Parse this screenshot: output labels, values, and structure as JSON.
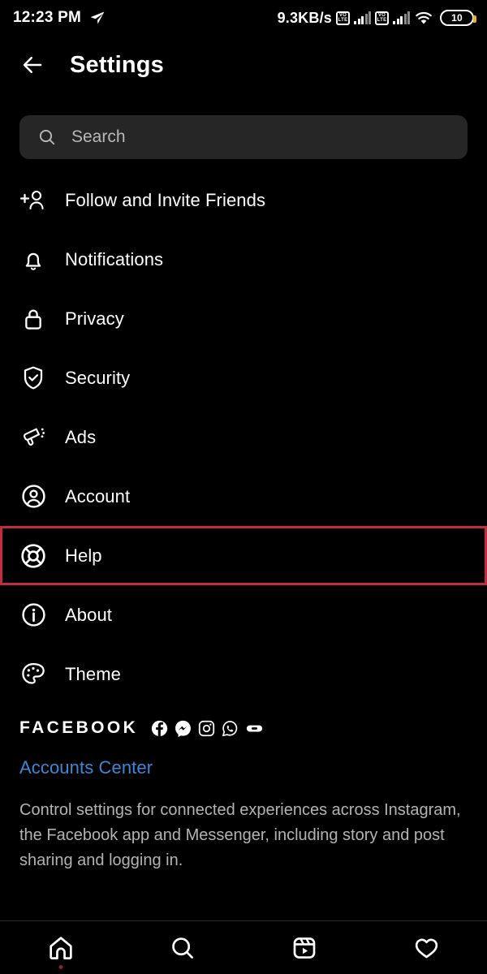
{
  "statusbar": {
    "time": "12:23 PM",
    "location_icon": "send-arrow-icon",
    "network_speed": "9.3KB/s",
    "sim1_label": "VOLTE",
    "sim1_top": "VO",
    "sim1_bottom": "LTE",
    "sim2_top": "VO",
    "sim2_bottom": "LTE",
    "wifi_icon": "wifi-icon",
    "battery_level": "10"
  },
  "header": {
    "back_icon": "back-arrow-icon",
    "title": "Settings"
  },
  "search": {
    "icon": "search-icon",
    "placeholder": "Search"
  },
  "menu": {
    "items": [
      {
        "label": "Follow and Invite Friends",
        "icon": "person-add-icon",
        "highlighted": false
      },
      {
        "label": "Notifications",
        "icon": "bell-icon",
        "highlighted": false
      },
      {
        "label": "Privacy",
        "icon": "lock-icon",
        "highlighted": false
      },
      {
        "label": "Security",
        "icon": "shield-check-icon",
        "highlighted": false
      },
      {
        "label": "Ads",
        "icon": "megaphone-icon",
        "highlighted": false
      },
      {
        "label": "Account",
        "icon": "user-circle-icon",
        "highlighted": false
      },
      {
        "label": "Help",
        "icon": "lifebuoy-icon",
        "highlighted": true
      },
      {
        "label": "About",
        "icon": "info-circle-icon",
        "highlighted": false
      },
      {
        "label": "Theme",
        "icon": "palette-icon",
        "highlighted": false
      }
    ]
  },
  "facebook": {
    "wordmark": "FACEBOOK",
    "app_icons": [
      "facebook-icon",
      "messenger-icon",
      "instagram-icon",
      "whatsapp-icon",
      "portal-icon"
    ],
    "accounts_center_link": "Accounts Center",
    "description": "Control settings for connected experiences across Instagram, the Facebook app and Messenger, including story and post sharing and logging in."
  },
  "bottomnav": {
    "items": [
      {
        "icon": "home-icon",
        "active": true
      },
      {
        "icon": "search-icon",
        "active": false
      },
      {
        "icon": "reels-icon",
        "active": false
      },
      {
        "icon": "heart-icon",
        "active": false
      }
    ]
  },
  "colors": {
    "background": "#000000",
    "highlight_border": "#c42b3e",
    "link": "#3b87d8",
    "search_field": "#262626",
    "muted_text": "#b3b3b3"
  }
}
